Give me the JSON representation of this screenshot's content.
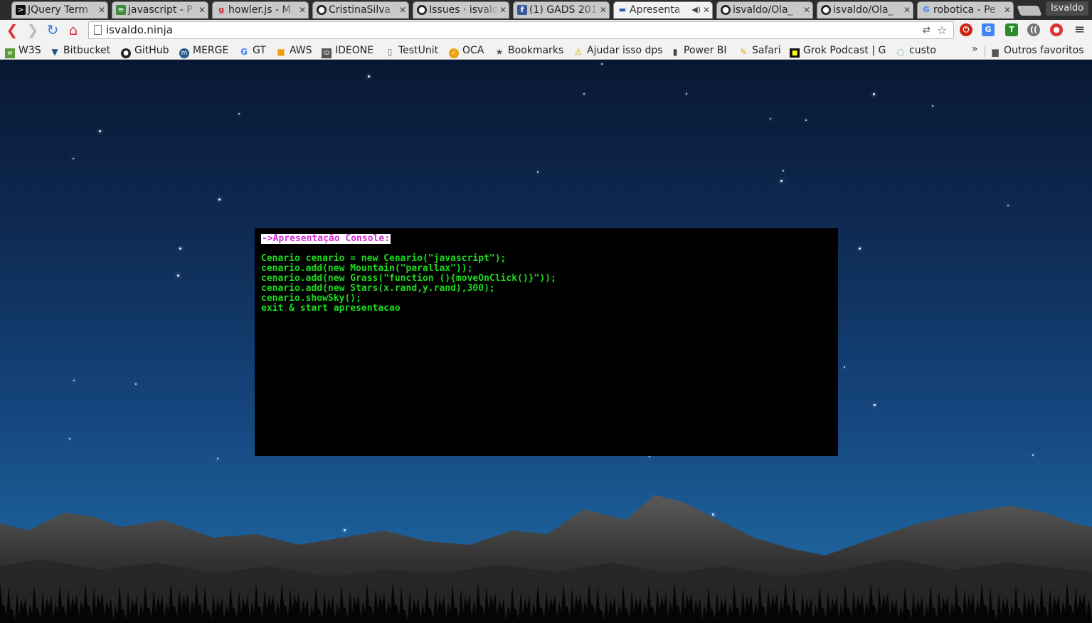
{
  "browser": {
    "tabs": [
      {
        "title": "JQuery Term",
        "icon": "terminal-icon"
      },
      {
        "title": "javascript - P",
        "icon": "stackoverflow-icon"
      },
      {
        "title": "howler.js - M",
        "icon": "howler-icon"
      },
      {
        "title": "CristinaSilva",
        "icon": "github-icon"
      },
      {
        "title": "Issues · isvald",
        "icon": "github-icon"
      },
      {
        "title": "(1) GADS 201",
        "icon": "facebook-icon"
      },
      {
        "title": "Apresenta",
        "icon": "page-icon",
        "active": true
      },
      {
        "title": "isvaldo/Ola_",
        "icon": "github-icon"
      },
      {
        "title": "isvaldo/Ola_",
        "icon": "github-icon"
      },
      {
        "title": "robotica - Pe",
        "icon": "google-icon"
      }
    ],
    "user_name": "Isvaldo",
    "url": "isvaldo.ninja",
    "bookmarks": [
      {
        "label": "W3S",
        "icon": "w3s-icon"
      },
      {
        "label": "Bitbucket",
        "icon": "bitbucket-icon"
      },
      {
        "label": "GitHub",
        "icon": "github-icon"
      },
      {
        "label": "MERGE",
        "icon": "merge-icon"
      },
      {
        "label": "GT",
        "icon": "google-translate-icon"
      },
      {
        "label": "AWS",
        "icon": "aws-icon"
      },
      {
        "label": "IDEONE",
        "icon": "ideone-icon"
      },
      {
        "label": "TestUnit",
        "icon": "page-icon"
      },
      {
        "label": "OCA",
        "icon": "oca-icon"
      },
      {
        "label": "Bookmarks",
        "icon": "star-icon"
      },
      {
        "label": "Ajudar isso dps",
        "icon": "warning-icon"
      },
      {
        "label": "Power BI",
        "icon": "powerbi-icon"
      },
      {
        "label": "Safari",
        "icon": "safari-icon"
      },
      {
        "label": "Grok Podcast | Gr",
        "icon": "grok-icon"
      },
      {
        "label": "custo",
        "icon": "refresh-icon"
      }
    ],
    "bookmarks_more": "»",
    "other_bookmarks": "Outros favoritos"
  },
  "console": {
    "prompt": "->Apresentação Console:",
    "lines": [
      "Cenario cenario = new Cenario(\"javascript\");",
      "cenario.add(new Mountain(\"parallax\"));",
      "cenario.add(new Grass(\"function (){moveOnClick()}\"));",
      "cenario.add(new Stars(x.rand,y.rand),300);",
      "cenario.showSky();",
      "exit & start apresentacao"
    ],
    "text_color": "#1bdc1b",
    "prompt_color": "#d62bd6"
  }
}
